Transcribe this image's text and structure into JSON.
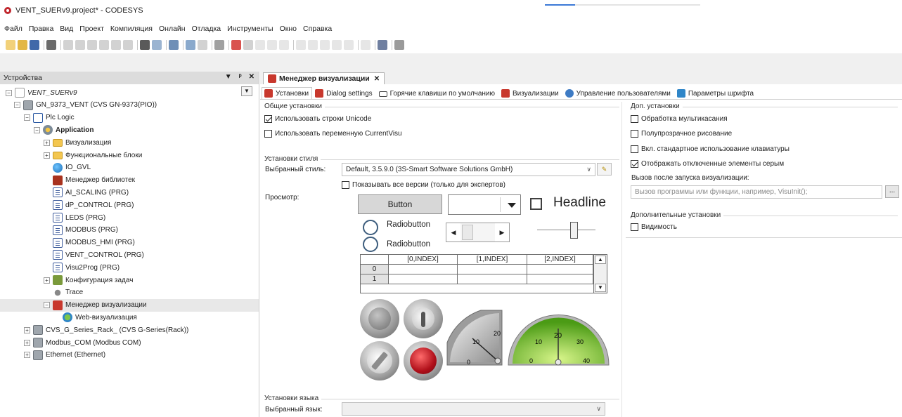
{
  "window": {
    "title": "VENT_SUERv9.project* - CODESYS"
  },
  "menu": [
    "Файл",
    "Правка",
    "Вид",
    "Проект",
    "Компиляция",
    "Онлайн",
    "Отладка",
    "Инструменты",
    "Окно",
    "Справка"
  ],
  "devices_panel": {
    "title": "Устройства",
    "controls": {
      "dropdown": "▼",
      "pin": "ᵖ",
      "close": "✕"
    },
    "tree": [
      {
        "label": "VENT_SUERv9",
        "icon": "project-icon",
        "italic": true,
        "expand": "−"
      },
      {
        "label": "GN_9373_VENT (CVS GN-9373(PIO))",
        "icon": "device-icon",
        "expand": "−"
      },
      {
        "label": "Plc Logic",
        "icon": "plc-logic-icon",
        "expand": "−"
      },
      {
        "label": "Application",
        "icon": "application-icon",
        "bold": true,
        "expand": "−"
      },
      {
        "label": "Визуализация",
        "icon": "folder-icon",
        "expand": "+"
      },
      {
        "label": "Функциональные блоки",
        "icon": "folder-icon",
        "expand": "+"
      },
      {
        "label": "IO_GVL",
        "icon": "gvl-icon"
      },
      {
        "label": "Менеджер библиотек",
        "icon": "library-manager-icon"
      },
      {
        "label": "AI_SCALING (PRG)",
        "icon": "program-icon"
      },
      {
        "label": "dP_CONTROL (PRG)",
        "icon": "program-icon"
      },
      {
        "label": "LEDS (PRG)",
        "icon": "program-icon"
      },
      {
        "label": "MODBUS (PRG)",
        "icon": "program-icon"
      },
      {
        "label": "MODBUS_HMI (PRG)",
        "icon": "program-icon"
      },
      {
        "label": "VENT_CONTROL (PRG)",
        "icon": "program-icon"
      },
      {
        "label": "Visu2Prog (PRG)",
        "icon": "program-icon"
      },
      {
        "label": "Конфигурация задач",
        "icon": "task-config-icon",
        "expand": "+"
      },
      {
        "label": "Trace",
        "icon": "trace-icon"
      },
      {
        "label": "Менеджер визуализации",
        "icon": "visu-manager-icon",
        "expand": "−",
        "selected": true
      },
      {
        "label": "Web-визуализация",
        "icon": "web-visu-icon"
      },
      {
        "label": "CVS_G_Series_Rack_ (CVS G-Series(Rack))",
        "icon": "device-icon",
        "expand": "+"
      },
      {
        "label": "Modbus_COM (Modbus COM)",
        "icon": "device-icon",
        "expand": "+"
      },
      {
        "label": "Ethernet (Ethernet)",
        "icon": "device-icon",
        "expand": "+"
      }
    ]
  },
  "editor": {
    "doc_tab": {
      "label": "Менеджер визуализации",
      "close": "✕"
    },
    "subtabs": [
      "Установки",
      "Dialog settings",
      "Горячие клавиши по умолчанию",
      "Визуализации",
      "Управление пользователями",
      "Параметры шрифта"
    ],
    "general": {
      "title": "Общие установки",
      "unicode": {
        "label": "Использовать строки Unicode",
        "checked": true
      },
      "currentvisu": {
        "label": "Использовать переменную CurrentVisu",
        "checked": false
      }
    },
    "style": {
      "title": "Установки стиля",
      "selected_label": "Выбранный стиль:",
      "selected_value": "Default, 3.5.9.0 (3S-Smart Software Solutions GmbH)",
      "show_all": {
        "label": "Показывать все версии (только для экспертов)",
        "checked": false
      },
      "preview_label": "Просмотр:"
    },
    "preview": {
      "button": "Button",
      "headline": "Headline",
      "radio1": "Radiobutton",
      "radio2": "Radiobutton",
      "table_headers": [
        "[0,INDEX]",
        "[1,INDEX]",
        "[2,INDEX]"
      ],
      "table_rows": [
        "0",
        "1"
      ],
      "gauge1": {
        "ticks": [
          "0",
          "10",
          "20"
        ]
      },
      "gauge2": {
        "ticks": [
          "0",
          "10",
          "20",
          "30",
          "40"
        ]
      }
    },
    "language": {
      "title": "Установки языка",
      "selected_label": "Выбранный язык:",
      "selected_value": ""
    },
    "extra": {
      "title": "Доп. установки",
      "multitouch": {
        "label": "Обработка мультикасания",
        "checked": false
      },
      "semitransparent": {
        "label": "Полупрозрачное рисование",
        "checked": false
      },
      "keyboard": {
        "label": "Вкл. стандартное использование клавиатуры",
        "checked": false
      },
      "disabled_gray": {
        "label": "Отображать отключенные элементы серым",
        "checked": true
      },
      "call_label": "Вызов после запуска визуализации:",
      "call_placeholder": "Вызов программы или функции, например, VisuInit();",
      "browse": "..."
    },
    "additional": {
      "title": "Дополнительные установки",
      "visibility": {
        "label": "Видимость",
        "checked": false
      }
    }
  }
}
